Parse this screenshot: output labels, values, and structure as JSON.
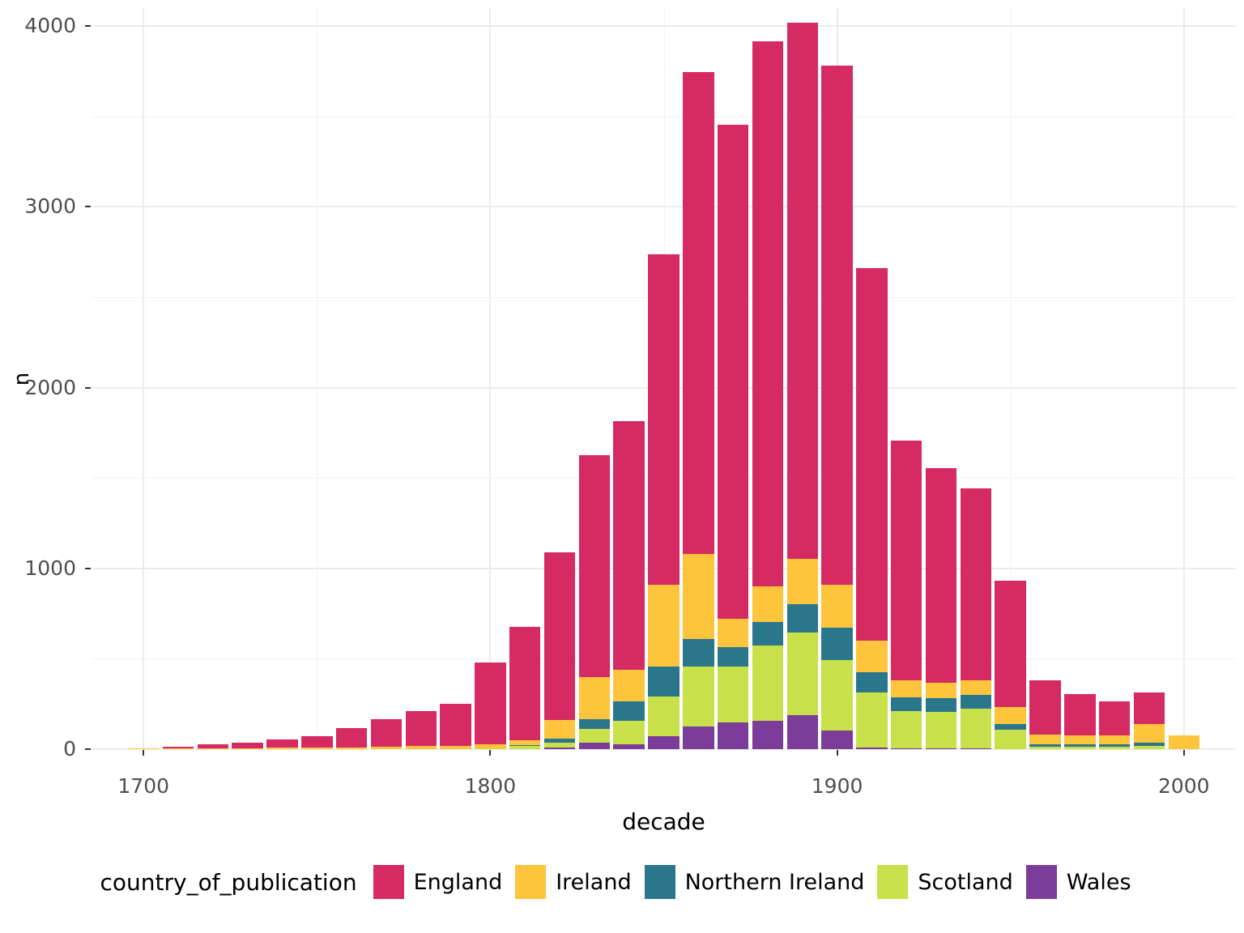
{
  "axes": {
    "y_title": "n",
    "x_title": "decade",
    "y_ticks": [
      0,
      1000,
      2000,
      3000,
      4000
    ],
    "y_tick_labels": [
      "0",
      "1000",
      "2000",
      "3000",
      "4000"
    ],
    "y_minor_ticks": [
      500,
      1500,
      2500,
      3500
    ],
    "x_ticks": [
      1700,
      1800,
      1900,
      2000
    ],
    "x_tick_labels": [
      "1700",
      "1800",
      "1900",
      "2000"
    ],
    "x_minor_ticks": [
      1750,
      1850,
      1950
    ]
  },
  "legend": {
    "title": "country_of_publication",
    "items": [
      {
        "label": "England",
        "color": "#D62A62"
      },
      {
        "label": "Ireland",
        "color": "#FDC43C"
      },
      {
        "label": "Northern Ireland",
        "color": "#2A778C"
      },
      {
        "label": "Scotland",
        "color": "#C8E049"
      },
      {
        "label": "Wales",
        "color": "#7B3D99"
      }
    ]
  },
  "chart_data": {
    "type": "bar",
    "title": "",
    "subtitle": "",
    "stacked": true,
    "xlabel": "decade",
    "ylabel": "n",
    "xlim": [
      1685,
      2015
    ],
    "ylim": [
      0,
      4100
    ],
    "grid": true,
    "legend_position": "bottom",
    "legend_title": "country_of_publication",
    "stack_order_bottom_to_top": [
      "Wales",
      "Scotland",
      "Northern Ireland",
      "Ireland",
      "England"
    ],
    "categories": [
      1700,
      1710,
      1720,
      1730,
      1740,
      1750,
      1760,
      1770,
      1780,
      1790,
      1800,
      1810,
      1820,
      1830,
      1840,
      1850,
      1860,
      1870,
      1880,
      1890,
      1900,
      1910,
      1920,
      1930,
      1940,
      1950,
      1960,
      1970,
      1980,
      1990,
      2000
    ],
    "series": [
      {
        "name": "England",
        "color": "#D62A62",
        "values": [
          0,
          8,
          20,
          32,
          46,
          62,
          105,
          150,
          195,
          230,
          455,
          630,
          925,
          1225,
          1375,
          1830,
          2665,
          2735,
          3015,
          2965,
          2870,
          2060,
          1330,
          1185,
          1065,
          700,
          300,
          230,
          190,
          175,
          0
        ]
      },
      {
        "name": "Ireland",
        "color": "#FDC43C",
        "values": [
          5,
          4,
          6,
          6,
          7,
          8,
          10,
          14,
          16,
          18,
          22,
          26,
          105,
          235,
          175,
          455,
          470,
          155,
          195,
          255,
          240,
          175,
          90,
          85,
          80,
          95,
          55,
          50,
          50,
          100,
          75
        ]
      },
      {
        "name": "Northern Ireland",
        "color": "#2A778C",
        "values": [
          0,
          0,
          0,
          0,
          0,
          0,
          0,
          0,
          0,
          0,
          0,
          6,
          20,
          55,
          110,
          165,
          155,
          110,
          130,
          155,
          175,
          110,
          80,
          80,
          75,
          30,
          15,
          14,
          14,
          22,
          0
        ]
      },
      {
        "name": "Scotland",
        "color": "#C8E049",
        "values": [
          0,
          0,
          0,
          0,
          0,
          0,
          0,
          0,
          0,
          2,
          4,
          14,
          30,
          75,
          130,
          220,
          330,
          305,
          420,
          455,
          390,
          305,
          205,
          200,
          220,
          105,
          12,
          12,
          12,
          16,
          0
        ]
      },
      {
        "name": "Wales",
        "color": "#7B3D99",
        "values": [
          0,
          0,
          0,
          0,
          0,
          0,
          0,
          0,
          0,
          0,
          0,
          2,
          8,
          35,
          25,
          70,
          125,
          150,
          155,
          190,
          105,
          10,
          4,
          4,
          4,
          2,
          0,
          0,
          0,
          0,
          0
        ]
      }
    ]
  }
}
